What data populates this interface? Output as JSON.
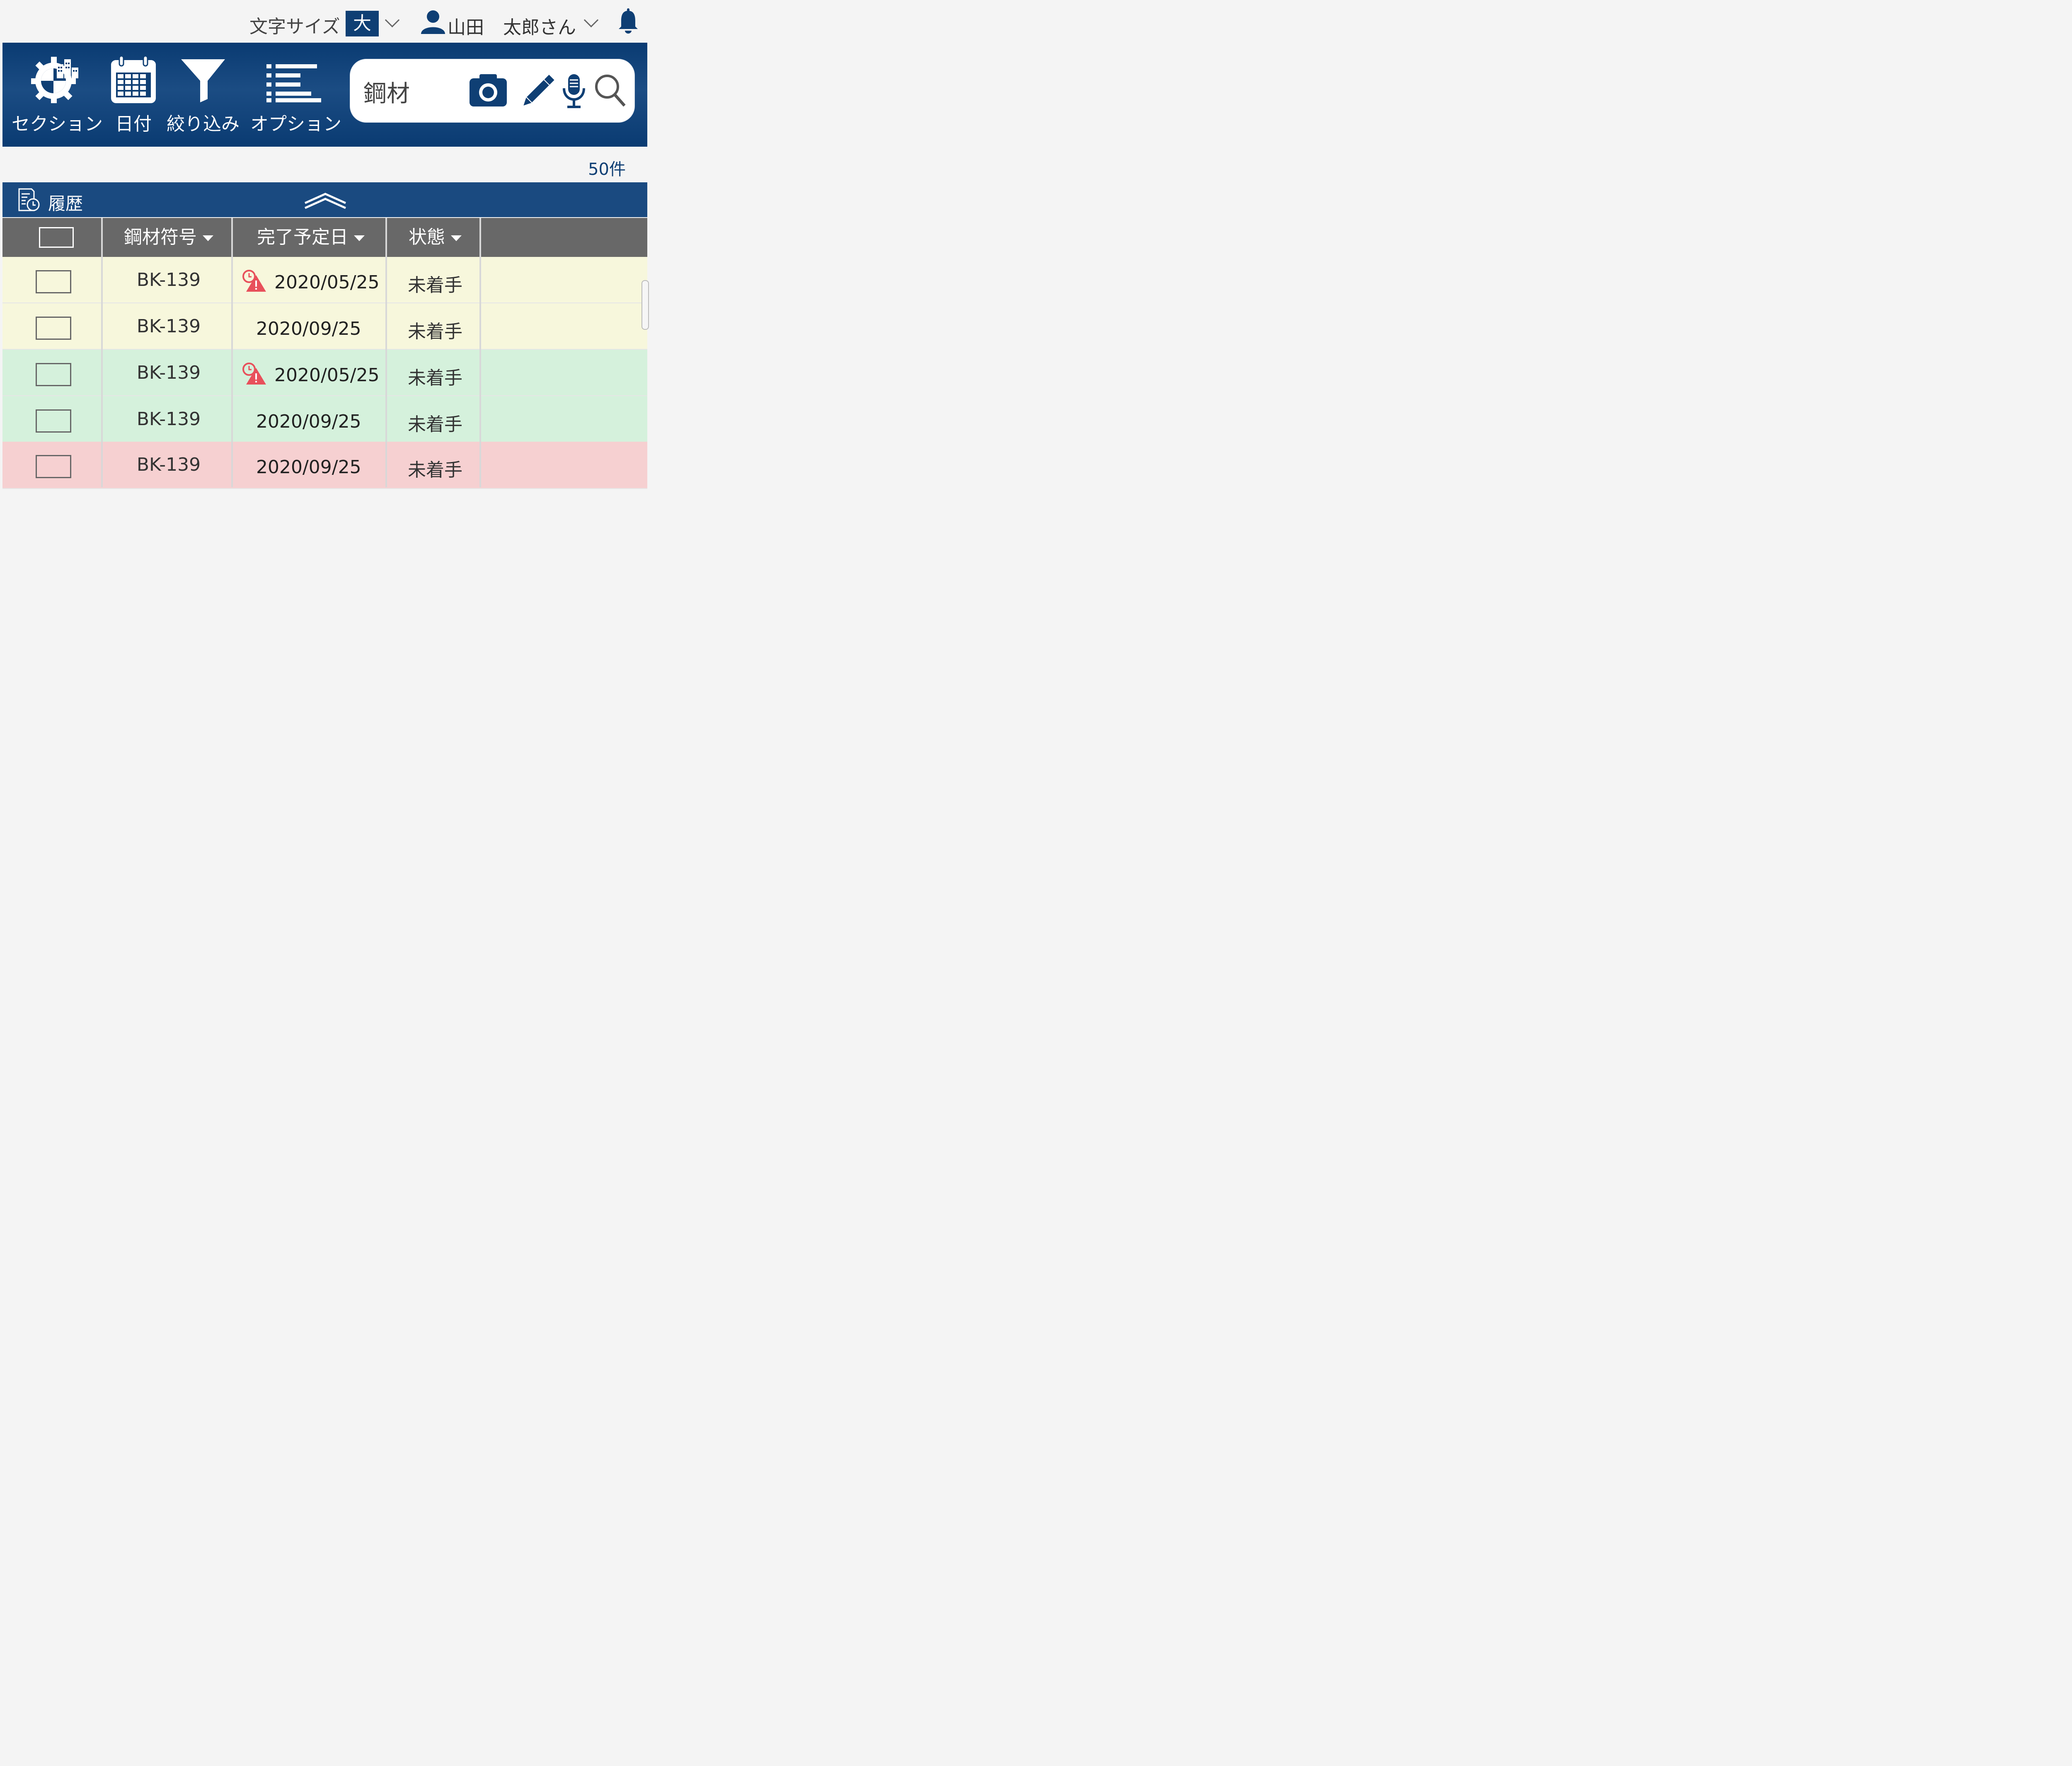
{
  "topbar": {
    "font_size_label": "文字サイズ",
    "font_size_value": "大",
    "user_family": "山田",
    "user_given": "太郎さん"
  },
  "toolbar": {
    "section_label": "セクション",
    "date_label": "日付",
    "filter_label": "絞り込み",
    "options_label": "オプション"
  },
  "search": {
    "query": "鋼材"
  },
  "result_count": "50件",
  "history": {
    "label": "履歴"
  },
  "table": {
    "columns": [
      "鋼材符号",
      "完了予定日",
      "状態"
    ],
    "rows": [
      {
        "code": "BK-139",
        "date": "2020/05/25",
        "status": "未着手",
        "overdue": true,
        "bg": "#f7f7dc"
      },
      {
        "code": "BK-139",
        "date": "2020/09/25",
        "status": "未着手",
        "overdue": false,
        "bg": "#f7f7dc"
      },
      {
        "code": "BK-139",
        "date": "2020/05/25",
        "status": "未着手",
        "overdue": true,
        "bg": "#d5f1dc"
      },
      {
        "code": "BK-139",
        "date": "2020/09/25",
        "status": "未着手",
        "overdue": false,
        "bg": "#d5f1dc"
      },
      {
        "code": "BK-139",
        "date": "2020/09/25",
        "status": "未着手",
        "overdue": false,
        "bg": "#f6d0d1"
      }
    ]
  },
  "colors": {
    "brand": "#0f3f74",
    "header_gray": "#686868",
    "alert": "#e8505b"
  },
  "icons": {
    "section": "section-gear-building-icon",
    "date": "calendar-icon",
    "filter": "funnel-icon",
    "options": "list-icon",
    "camera": "camera-icon",
    "pencil": "pencil-icon",
    "mic": "microphone-icon",
    "search": "search-icon",
    "user": "user-icon",
    "bell": "bell-icon",
    "history": "history-document-icon",
    "collapse": "chevron-up-double-icon",
    "overdue": "overdue-alert-icon"
  }
}
